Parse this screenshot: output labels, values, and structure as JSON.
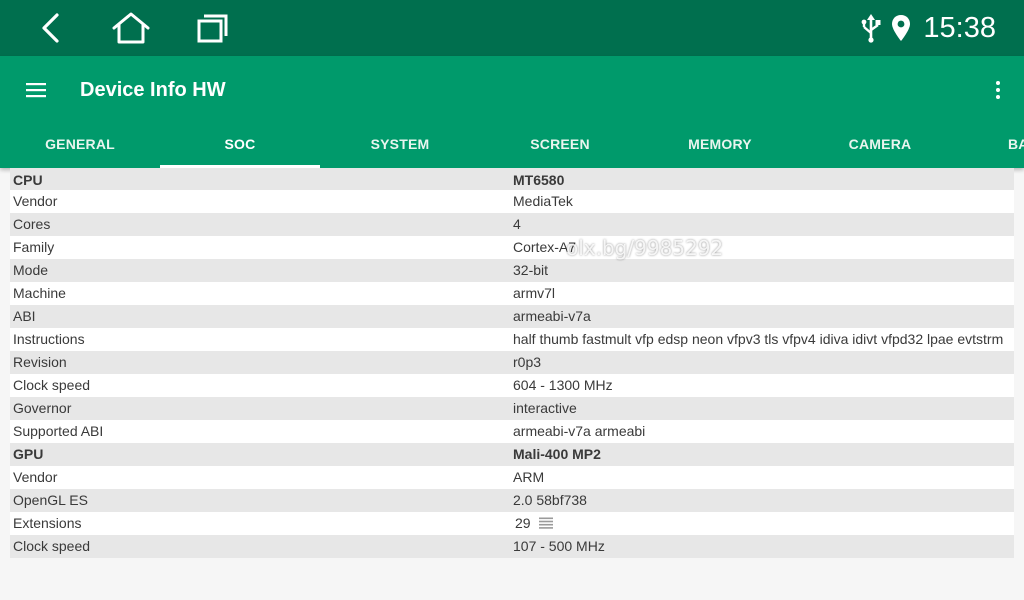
{
  "status_bar": {
    "time": "15:38",
    "nav_icons": [
      "back-icon",
      "home-icon",
      "recents-icon"
    ],
    "status_icons": [
      "usb-icon",
      "location-icon"
    ]
  },
  "toolbar": {
    "title": "Device Info HW",
    "menu_icon": "hamburger-menu-icon",
    "overflow_icon": "more-vert-icon"
  },
  "tabs": [
    {
      "label": "GENERAL"
    },
    {
      "label": "SOC"
    },
    {
      "label": "SYSTEM"
    },
    {
      "label": "SCREEN"
    },
    {
      "label": "MEMORY"
    },
    {
      "label": "CAMERA"
    },
    {
      "label": "BA"
    }
  ],
  "active_tab": "SOC",
  "rows": [
    {
      "key": "CPU",
      "value": "MT6580",
      "header": true
    },
    {
      "key": "Vendor",
      "value": "MediaTek"
    },
    {
      "key": "Cores",
      "value": "4"
    },
    {
      "key": "Family",
      "value": "Cortex-A7"
    },
    {
      "key": "Mode",
      "value": "32-bit"
    },
    {
      "key": "Machine",
      "value": "armv7l"
    },
    {
      "key": "ABI",
      "value": "armeabi-v7a"
    },
    {
      "key": "Instructions",
      "value": "half thumb fastmult vfp edsp neon vfpv3 tls vfpv4 idiva idivt vfpd32 lpae evtstrm"
    },
    {
      "key": "Revision",
      "value": "r0p3"
    },
    {
      "key": "Clock speed",
      "value": "604 - 1300 MHz"
    },
    {
      "key": "Governor",
      "value": "interactive"
    },
    {
      "key": "Supported ABI",
      "value": "armeabi-v7a armeabi"
    },
    {
      "key": "GPU",
      "value": "Mali-400 MP2",
      "header": true
    },
    {
      "key": "Vendor",
      "value": "ARM"
    },
    {
      "key": "OpenGL ES",
      "value": "2.0 58bf738"
    },
    {
      "key": "Extensions",
      "value": "29"
    },
    {
      "key": "Clock speed",
      "value": "107 - 500 MHz"
    }
  ],
  "watermark": "olx.bg/9985292",
  "colors": {
    "status_bar": "#006f4e",
    "toolbar": "#009a6b",
    "row_alt": "#e7e7e7"
  }
}
